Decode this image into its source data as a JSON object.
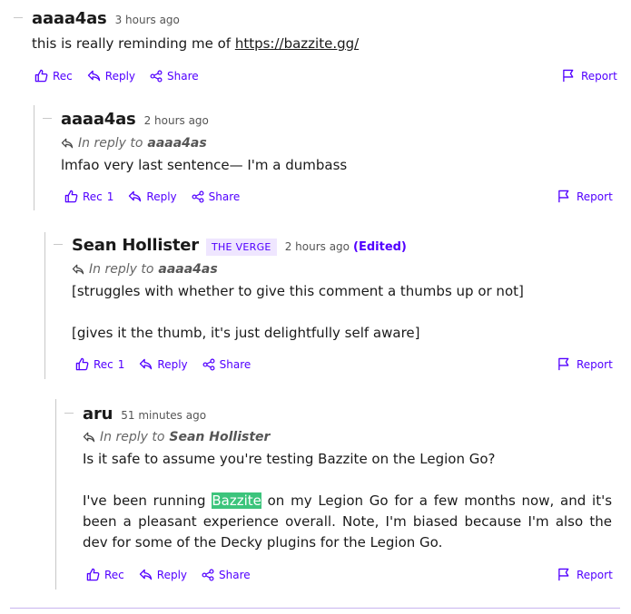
{
  "labels": {
    "rec": "Rec",
    "reply": "Reply",
    "share": "Share",
    "report": "Report",
    "in_reply_to": "In reply to"
  },
  "comments": [
    {
      "author": "aaaa4as",
      "time": "3 hours ago",
      "body_text": "this is really reminding me of ",
      "link": "https://bazzite.gg/",
      "rec_count": ""
    },
    {
      "author": "aaaa4as",
      "time": "2 hours ago",
      "reply_to": "aaaa4as",
      "body": "lmfao very last sentence— I'm a dumbass",
      "rec_count": "1"
    },
    {
      "author": "Sean Hollister",
      "badge": "THE VERGE",
      "time": "2 hours ago",
      "edited": "(Edited)",
      "reply_to": "aaaa4as",
      "paragraphs": [
        "[struggles with whether to give this comment a thumbs up or not]",
        "[gives it the thumb, it's just delightfully self aware]"
      ],
      "rec_count": "1"
    },
    {
      "author": "aru",
      "time": "51 minutes ago",
      "reply_to": "Sean Hollister",
      "p1": "Is it safe to assume you're testing Bazzite on the Legion Go?",
      "p2_pre": "I've been running ",
      "p2_highlight": "Bazzite",
      "p2_post": " on my Legion Go for a few months now, and it's been a pleasant experience overall. Note, I'm biased because I'm also the dev for some of the Decky plugins for the Legion Go.",
      "rec_count": ""
    }
  ],
  "colors": {
    "accent": "#5200ff",
    "highlight": "#3cc47c",
    "badge_bg": "#efe6ff"
  }
}
